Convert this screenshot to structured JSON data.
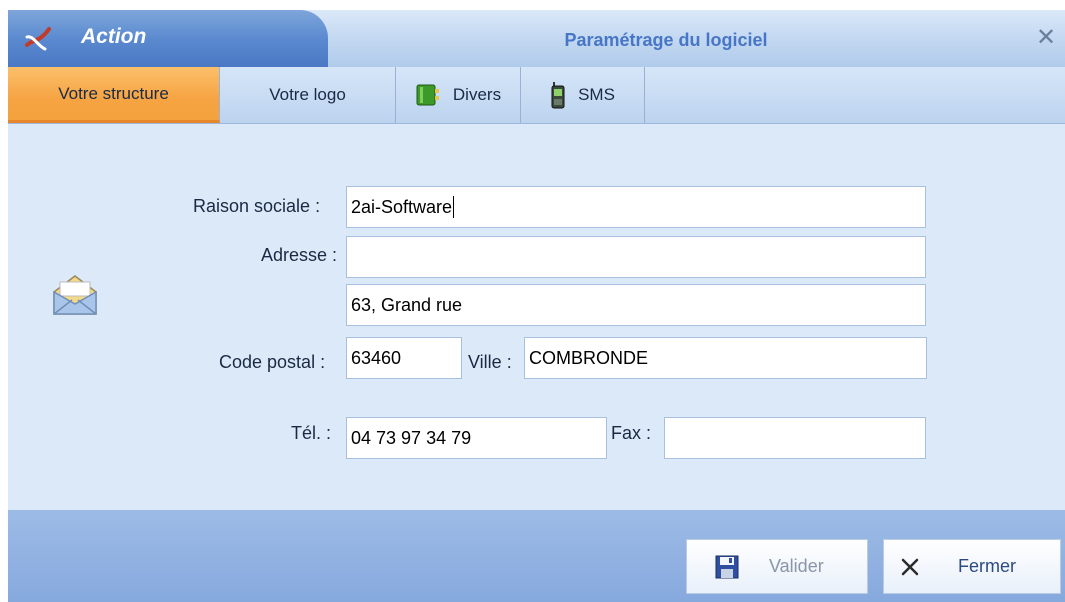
{
  "window": {
    "app_name": "Action",
    "title": "Paramétrage du logiciel",
    "close_symbol": "✕"
  },
  "tabs": [
    {
      "label": "Votre structure",
      "icon": "",
      "active": true
    },
    {
      "label": "Votre logo",
      "icon": "",
      "active": false
    },
    {
      "label": "Divers",
      "icon": "green-book-icon",
      "active": false
    },
    {
      "label": "SMS",
      "icon": "mobile-phone-icon",
      "active": false
    }
  ],
  "form": {
    "raison_sociale": {
      "label": "Raison sociale :",
      "value": "2ai-Software"
    },
    "adresse": {
      "label": "Adresse :",
      "line1": "",
      "line2": "63, Grand rue"
    },
    "code_postal": {
      "label": "Code postal :",
      "value": "63460"
    },
    "ville": {
      "label": "Ville :",
      "value": "COMBRONDE"
    },
    "tel": {
      "label": "Tél. :",
      "value": "04 73 97 34 79"
    },
    "fax": {
      "label": "Fax :",
      "value": ""
    },
    "decor_icon": "envelope-icon"
  },
  "buttons": {
    "valider": {
      "label": "Valider",
      "icon": "floppy-disk-icon",
      "enabled": false
    },
    "fermer": {
      "label": "Fermer",
      "icon": "close-x-icon",
      "enabled": true
    }
  },
  "colors": {
    "active_tab": "#f6a443",
    "title_text": "#4876c7",
    "content_bg": "#dce9f8",
    "footer_bg": "#8fb0e0"
  }
}
